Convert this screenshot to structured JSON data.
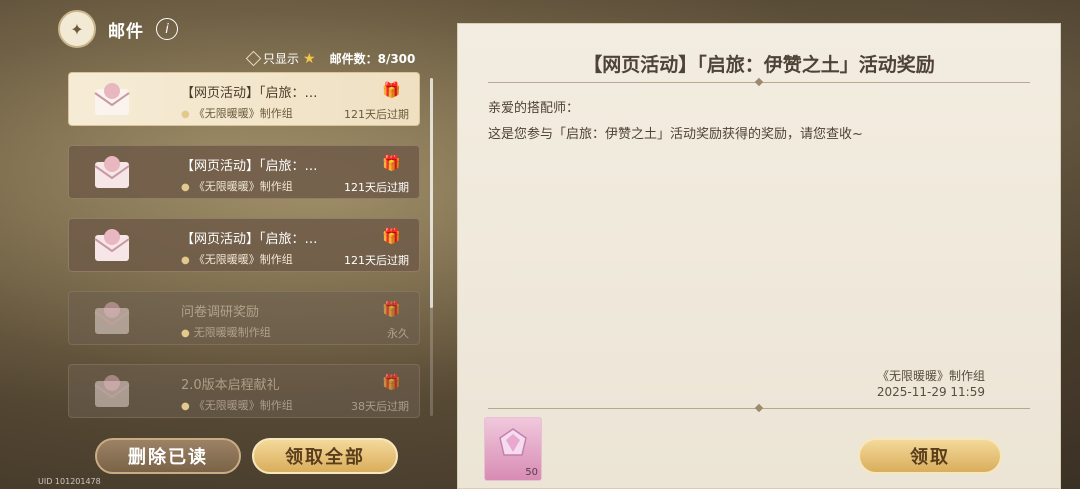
{
  "header": {
    "title": "邮件",
    "info_icon": "i"
  },
  "filter": {
    "only_show_label": "只显示",
    "count_label": "邮件数：",
    "count_value": "8/300"
  },
  "mails": [
    {
      "subject": "【网页活动】「启旅：…",
      "sender": "《无限暖暖》制作组",
      "expire": "121天后过期",
      "state": "selected"
    },
    {
      "subject": "【网页活动】「启旅：…",
      "sender": "《无限暖暖》制作组",
      "expire": "121天后过期",
      "state": "unread"
    },
    {
      "subject": "【网页活动】「启旅：…",
      "sender": "《无限暖暖》制作组",
      "expire": "121天后过期",
      "state": "unread"
    },
    {
      "subject": "问卷调研奖励",
      "sender": "无限暖暖制作组",
      "expire": "永久",
      "state": "read"
    },
    {
      "subject": "2.0版本启程献礼",
      "sender": "《无限暖暖》制作组",
      "expire": "38天后过期",
      "state": "read"
    }
  ],
  "buttons": {
    "delete_read": "删除已读",
    "claim_all": "领取全部",
    "claim": "领取"
  },
  "uid": "UID 101201478",
  "detail": {
    "title": "【网页活动】「启旅：伊赞之土」活动奖励",
    "greeting": "亲爱的搭配师：",
    "body": "这是您参与「启旅：伊赞之土」活动奖励获得的奖励，请您查收~",
    "signature": "《无限暖暖》制作组",
    "date": "2025-11-29 11:59",
    "reward_count": "50"
  },
  "colors": {
    "accent_gold": "#d9ad5c",
    "panel_bg": "#f3ede1",
    "reward_pink": "#d88cb4"
  }
}
